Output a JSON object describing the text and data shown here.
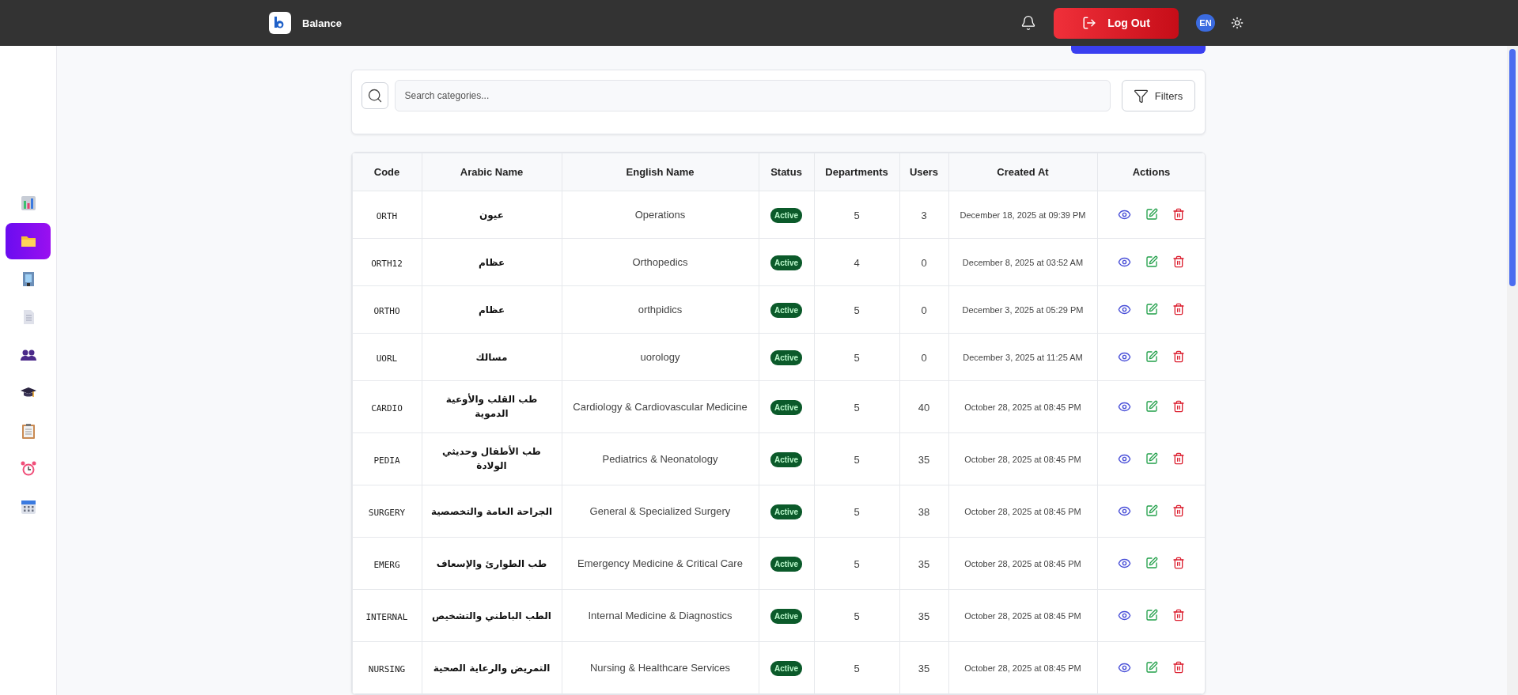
{
  "topbar": {
    "brand": "Balance",
    "logout": "Log Out",
    "language": "EN"
  },
  "sidebar": {
    "items": [
      {
        "selected": false
      },
      {
        "selected": true
      },
      {
        "selected": false
      },
      {
        "selected": false
      },
      {
        "selected": false
      },
      {
        "selected": false
      },
      {
        "selected": false
      },
      {
        "selected": false
      },
      {
        "selected": false
      }
    ]
  },
  "search": {
    "placeholder": "Search categories...",
    "filters": "Filters"
  },
  "table": {
    "columns": [
      "Code",
      "Arabic Name",
      "English Name",
      "Status",
      "Departments",
      "Users",
      "Created At",
      "Actions"
    ],
    "rows": [
      {
        "code": "ORTH",
        "arabic": "عيون",
        "english": "Operations",
        "status": "Active",
        "departments": "5",
        "users": "3",
        "created": "December 18, 2025 at 09:39 PM"
      },
      {
        "code": "ORTH12",
        "arabic": "عظام",
        "english": "Orthopedics",
        "status": "Active",
        "departments": "4",
        "users": "0",
        "created": "December 8, 2025 at 03:52 AM"
      },
      {
        "code": "ORTHO",
        "arabic": "عظام",
        "english": "orthpidics",
        "status": "Active",
        "departments": "5",
        "users": "0",
        "created": "December 3, 2025 at 05:29 PM"
      },
      {
        "code": "UORL",
        "arabic": "مسالك",
        "english": "uorology",
        "status": "Active",
        "departments": "5",
        "users": "0",
        "created": "December 3, 2025 at 11:25 AM"
      },
      {
        "code": "CARDIO",
        "arabic": "طب القلب والأوعية الدموية",
        "english": "Cardiology & Cardiovascular Medicine",
        "status": "Active",
        "departments": "5",
        "users": "40",
        "created": "October 28, 2025 at 08:45 PM"
      },
      {
        "code": "PEDIA",
        "arabic": "طب الأطفال وحديثي الولادة",
        "english": "Pediatrics & Neonatology",
        "status": "Active",
        "departments": "5",
        "users": "35",
        "created": "October 28, 2025 at 08:45 PM"
      },
      {
        "code": "SURGERY",
        "arabic": "الجراحة العامة والتخصصية",
        "english": "General & Specialized Surgery",
        "status": "Active",
        "departments": "5",
        "users": "38",
        "created": "October 28, 2025 at 08:45 PM"
      },
      {
        "code": "EMERG",
        "arabic": "طب الطوارئ والإسعاف",
        "english": "Emergency Medicine & Critical Care",
        "status": "Active",
        "departments": "5",
        "users": "35",
        "created": "October 28, 2025 at 08:45 PM"
      },
      {
        "code": "INTERNAL",
        "arabic": "الطب الباطني والتشخيص",
        "english": "Internal Medicine & Diagnostics",
        "status": "Active",
        "departments": "5",
        "users": "35",
        "created": "October 28, 2025 at 08:45 PM"
      },
      {
        "code": "NURSING",
        "arabic": "التمريض والرعاية الصحية",
        "english": "Nursing & Healthcare Services",
        "status": "Active",
        "departments": "5",
        "users": "35",
        "created": "October 28, 2025 at 08:45 PM"
      }
    ]
  }
}
